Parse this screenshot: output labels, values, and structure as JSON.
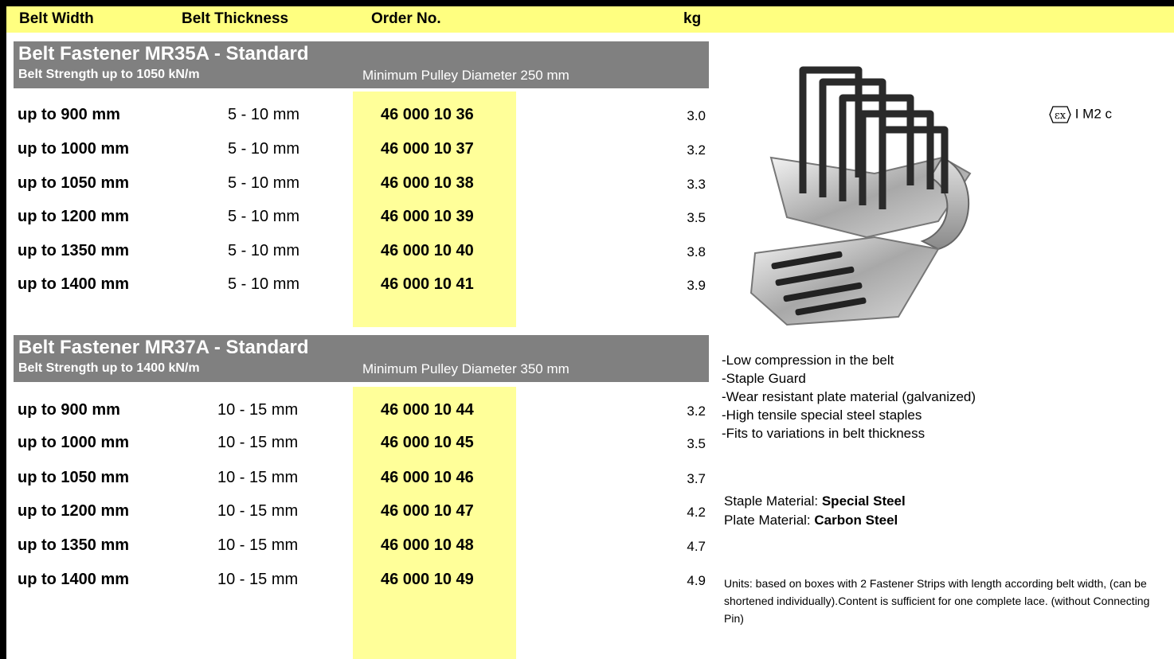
{
  "header": {
    "belt_width": "Belt Width",
    "belt_thickness": "Belt Thickness",
    "order_no": "Order No.",
    "kg": "kg"
  },
  "sections": [
    {
      "title": "Belt Fastener MR35A - Standard",
      "strength": "Belt Strength up to 1050 kN/m",
      "pulley": "Minimum Pulley Diameter 250 mm",
      "rows": [
        {
          "width": "up to   900 mm",
          "thickness": "5 - 10 mm",
          "order": "46 000 10 36",
          "kg": "3.0"
        },
        {
          "width": "up to 1000 mm",
          "thickness": "5 - 10 mm",
          "order": "46 000 10 37",
          "kg": "3.2"
        },
        {
          "width": "up to 1050 mm",
          "thickness": "5 - 10 mm",
          "order": "46 000 10 38",
          "kg": "3.3"
        },
        {
          "width": "up to 1200 mm",
          "thickness": "5 - 10 mm",
          "order": "46 000 10 39",
          "kg": "3.5"
        },
        {
          "width": "up to 1350 mm",
          "thickness": "5 - 10 mm",
          "order": "46 000 10 40",
          "kg": "3.8"
        },
        {
          "width": "up to 1400 mm",
          "thickness": "5 - 10 mm",
          "order": "46 000 10 41",
          "kg": "3.9"
        }
      ]
    },
    {
      "title": "Belt Fastener MR37A  - Standard",
      "strength": "Belt Strength up to 1400 kN/m",
      "pulley": "Minimum Pulley Diameter 350 mm",
      "rows": [
        {
          "width": "up to   900 mm",
          "thickness": "10 - 15 mm",
          "order": "46 000 10 44",
          "kg": "3.2"
        },
        {
          "width": "up to 1000 mm",
          "thickness": "10 - 15 mm",
          "order": "46 000 10 45",
          "kg": "3.5"
        },
        {
          "width": "up to 1050 mm",
          "thickness": "10 - 15 mm",
          "order": "46 000 10 46",
          "kg": "3.7"
        },
        {
          "width": "up to 1200 mm",
          "thickness": "10 - 15 mm",
          "order": "46 000 10 47",
          "kg": "4.2"
        },
        {
          "width": "up to 1350 mm",
          "thickness": "10 - 15 mm",
          "order": "46 000 10 48",
          "kg": "4.7"
        },
        {
          "width": "up to 1400 mm",
          "thickness": "10 - 15 mm",
          "order": "46 000 10 49",
          "kg": "4.9"
        }
      ]
    }
  ],
  "ex_mark": {
    "symbol": "εx",
    "text": "I M2 c"
  },
  "features": [
    "-Low compression in the belt",
    "-Staple Guard",
    "-Wear resistant plate material (galvanized)",
    "-High tensile special steel staples",
    "-Fits to variations in belt thickness"
  ],
  "materials": {
    "staple_label": "Staple Material: ",
    "staple_value": "Special Steel",
    "plate_label": "Plate Material: ",
    "plate_value": "Carbon Steel"
  },
  "units_note": "Units: based on boxes with 2 Fastener Strips with length according belt width, (can be shortened individually).Content is sufficient for one complete lace. (without Connecting Pin)",
  "colors": {
    "header_bg": "#ffff80",
    "section_bg": "#808080",
    "order_col_bg": "#ffff99"
  }
}
